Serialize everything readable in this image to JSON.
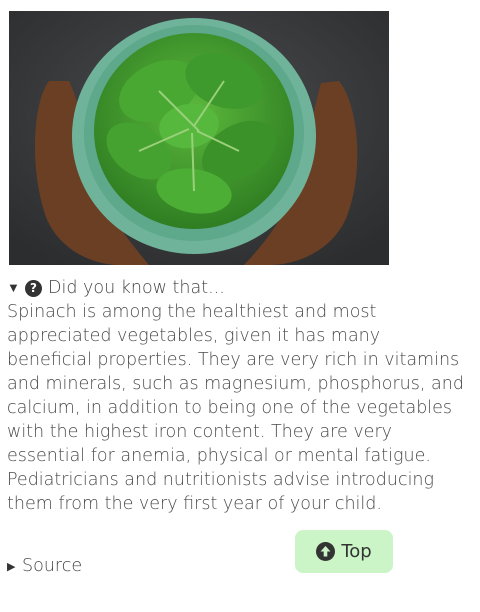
{
  "image": {
    "subject": "spinach-bowl-photo"
  },
  "details": {
    "expanded": true,
    "toggle_glyph": "▼",
    "icon": "question-circle-icon",
    "summary": "Did you know that...",
    "text": "Spinach is among the healthiest and most appreciated vegetables, given it has many beneficial properties. They are very rich in vitamins and minerals, such as magnesium, phosphorus, and calcium, in addition to being one of the vegetables with the highest iron content. They are very essential for anemia, physical or mental fatigue. Pediatricians and nutritionists advise introducing them from the very first year of your child."
  },
  "source": {
    "toggle_glyph": "▶",
    "label": "Source"
  },
  "top_button": {
    "icon": "arrow-up-circle-icon",
    "label": "Top",
    "background": "#ccf5c7"
  },
  "colors": {
    "text": "#4a4a4a",
    "photo_background": "#3a3b3d",
    "bowl": "#6fb39a",
    "leaf": "#3f9b2e"
  }
}
